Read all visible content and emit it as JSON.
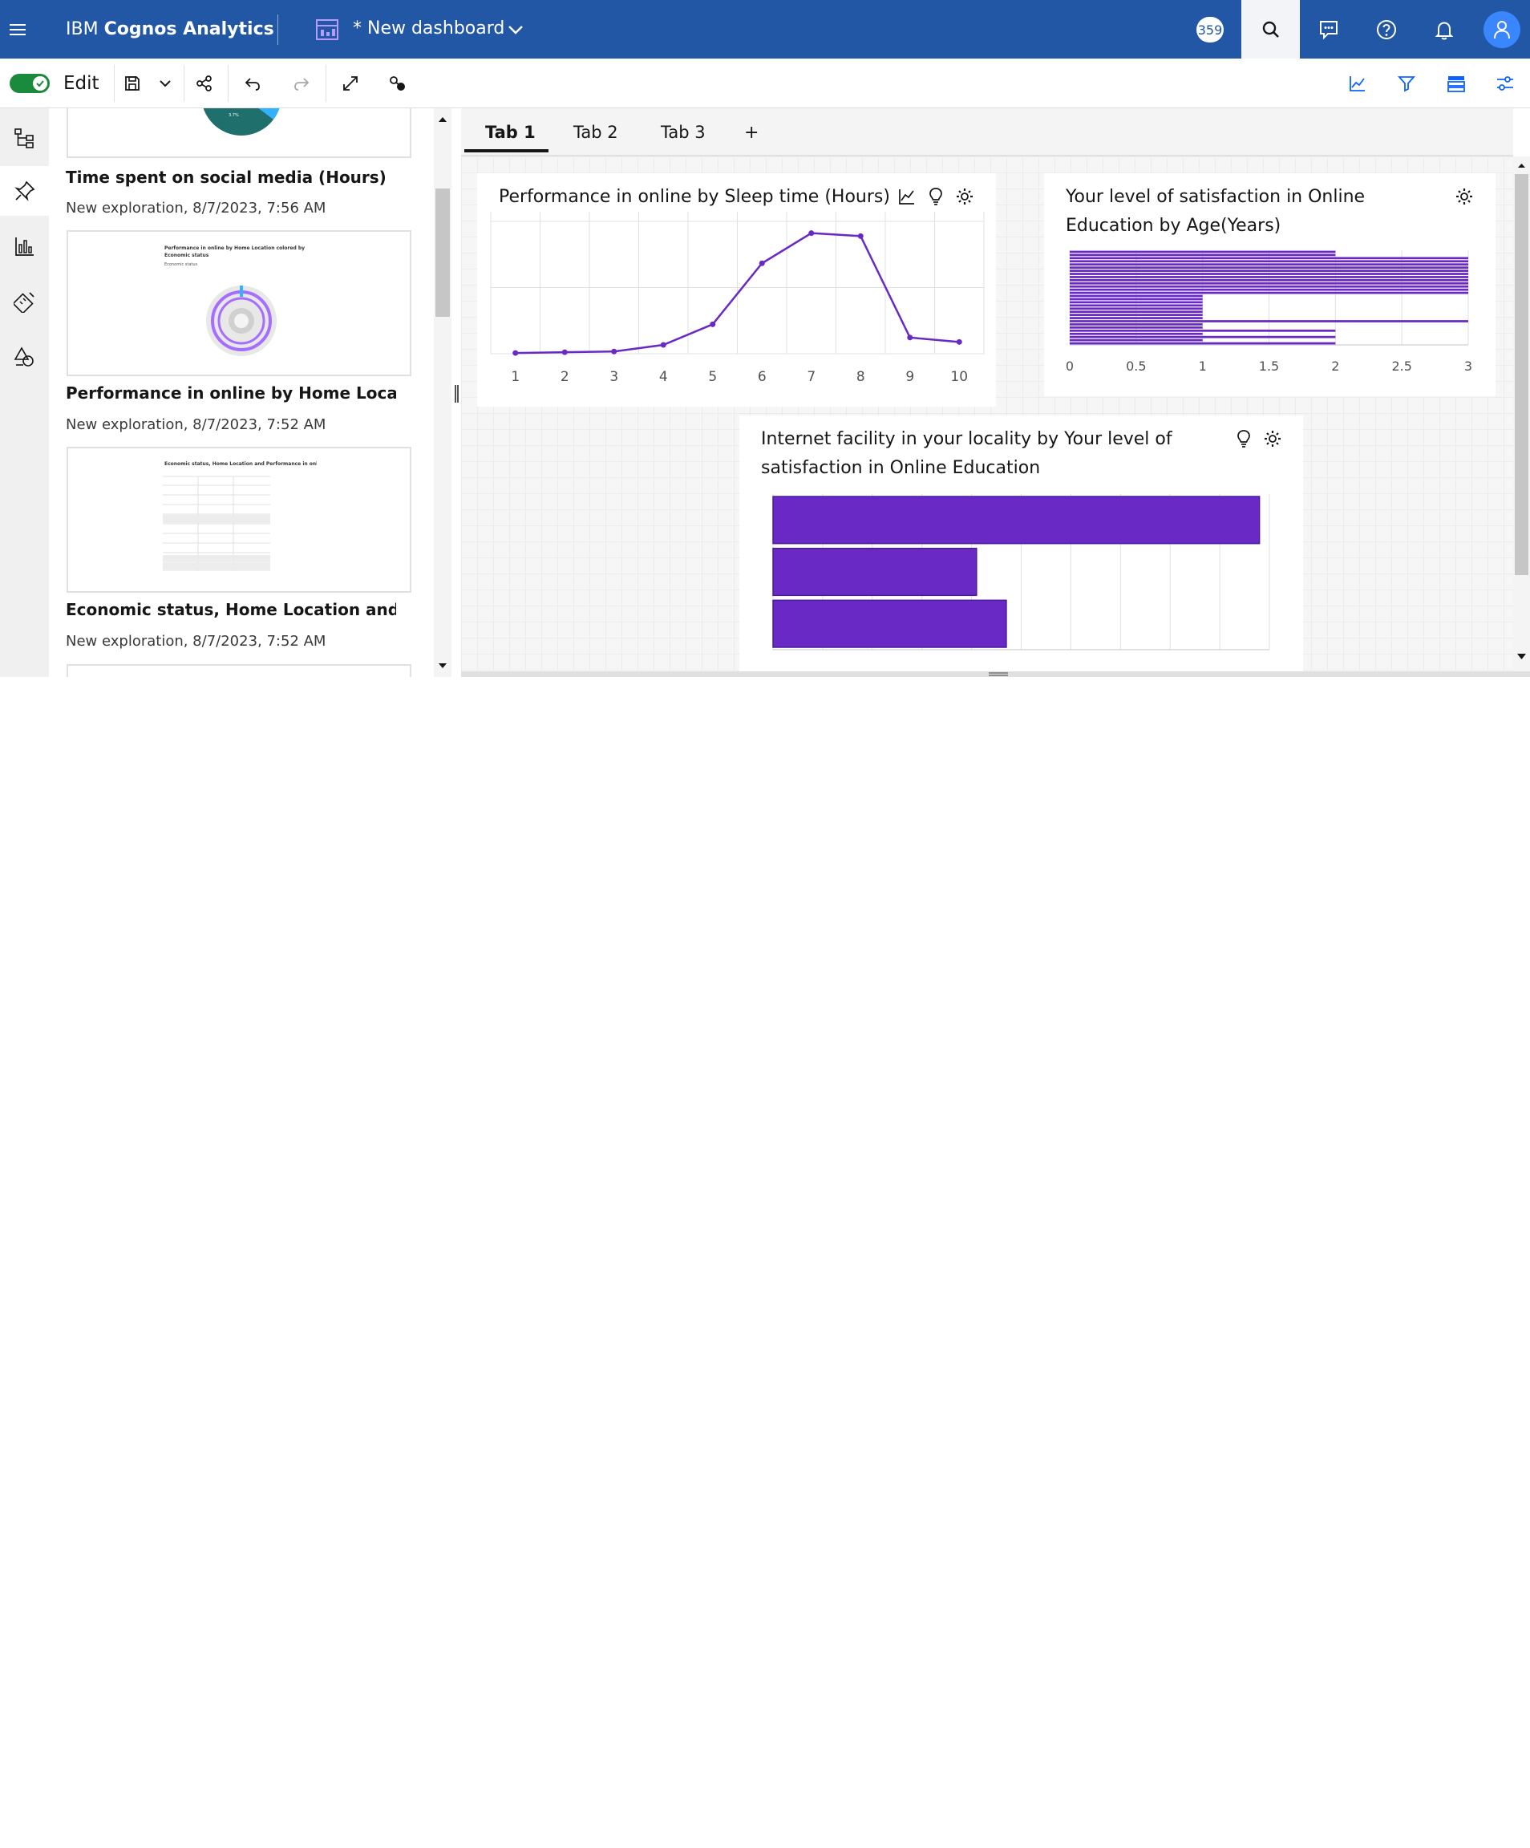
{
  "header": {
    "brand_prefix": "IBM ",
    "brand_name": "Cognos Analytics",
    "dashboard_title": "* New dashboard",
    "badge_count": "359"
  },
  "toolbar": {
    "edit_label": "Edit",
    "edit_mode_on": true
  },
  "panel": {
    "cards": [
      {
        "title": "Time spent on social media (Hours)",
        "meta": "New exploration, 8/7/2023, 7:56 AM"
      },
      {
        "title": "Performance in online by Home Location colored by Economic status",
        "meta": "New exploration, 8/7/2023, 7:52 AM",
        "thumb_title": "Performance in online by Home Location colored by Economic status",
        "thumb_legend": "Economic status"
      },
      {
        "title": "Economic status, Home Location and Performance in online",
        "meta": "New exploration, 8/7/2023, 7:52 AM",
        "thumb_title": "Economic status, Home Location and Performance in online"
      }
    ]
  },
  "tabs": [
    {
      "label": "Tab 1",
      "active": true
    },
    {
      "label": "Tab 2",
      "active": false
    },
    {
      "label": "Tab 3",
      "active": false
    }
  ],
  "add_tab_label": "+",
  "icons": {
    "menu": "hamburger-icon",
    "dashboard": "dashboard-icon",
    "search": "search-icon",
    "chat": "chat-icon",
    "help": "help-icon",
    "notifications": "bell-icon",
    "user": "user-icon"
  },
  "colors": {
    "header": "#2157a5",
    "series": "#6929c4",
    "toggle": "#1a8a3c"
  },
  "widgets": {
    "line": {
      "title": "Performance in online by Sleep time (Hours)"
    },
    "barh_age": {
      "title": "Your level of satisfaction in Online Education by Age(Years)"
    },
    "barh_internet": {
      "title": "Internet facility in your locality by Your level of satisfaction in Online Education"
    }
  },
  "chart_data": [
    {
      "type": "line",
      "title": "Performance in online by Sleep time (Hours)",
      "categories": [
        "1",
        "2",
        "3",
        "4",
        "5",
        "6",
        "7",
        "8",
        "9",
        "10"
      ],
      "values": [
        1,
        2,
        3,
        12,
        40,
        123,
        164,
        160,
        22,
        16
      ],
      "ylim": [
        0,
        180
      ],
      "grid": true,
      "xlabel": "",
      "ylabel": ""
    },
    {
      "type": "bar",
      "orientation": "horizontal",
      "title": "Your level of satisfaction in Online Education by Age(Years)",
      "xticks": [
        "0",
        "0.5",
        "1",
        "1.5",
        "2",
        "2.5",
        "3"
      ],
      "xlim": [
        0,
        3
      ],
      "values": [
        2,
        2,
        3,
        3,
        3,
        3,
        3,
        3,
        3,
        3,
        3,
        3,
        3,
        3,
        1,
        1,
        1,
        1,
        1,
        1,
        1,
        1,
        3,
        1,
        1,
        2,
        1,
        2,
        1,
        2
      ],
      "grid": true
    },
    {
      "type": "bar",
      "orientation": "horizontal",
      "title": "Internet facility in your locality by Your level of satisfaction in Online Education",
      "values": [
        9.8,
        4.1,
        4.7
      ],
      "xlim": [
        0,
        10
      ],
      "grid": true
    }
  ]
}
